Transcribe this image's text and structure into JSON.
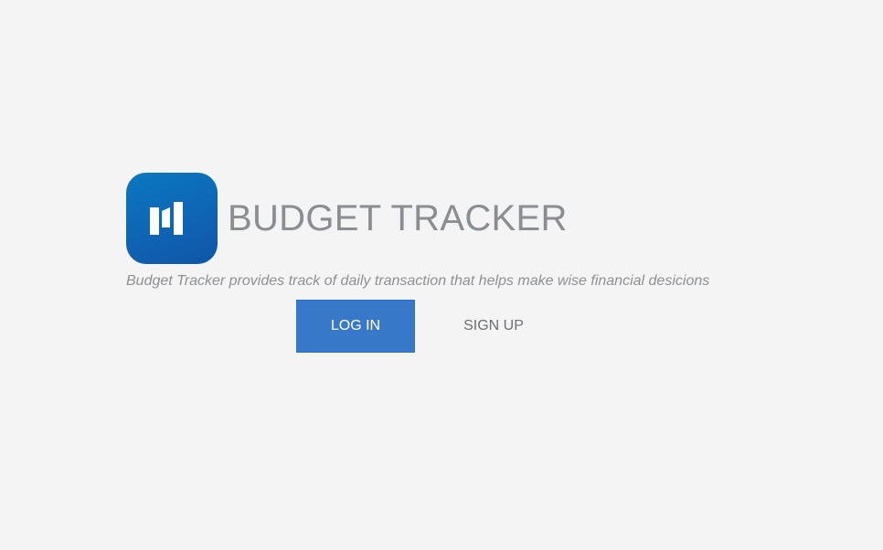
{
  "brand": {
    "title": "BUDGET TRACKER",
    "logo_icon": "budget-tracker-logo-icon",
    "logo_colors": [
      "#0a78c2",
      "#1155a8"
    ]
  },
  "tagline": "Budget Tracker provides track of daily transaction that helps make wise financial desicions",
  "actions": {
    "login_label": "LOG IN",
    "signup_label": "SIGN UP"
  },
  "colors": {
    "background": "#f4f4f4",
    "primary_button": "#3779c8",
    "title_text": "#8a8d91"
  }
}
